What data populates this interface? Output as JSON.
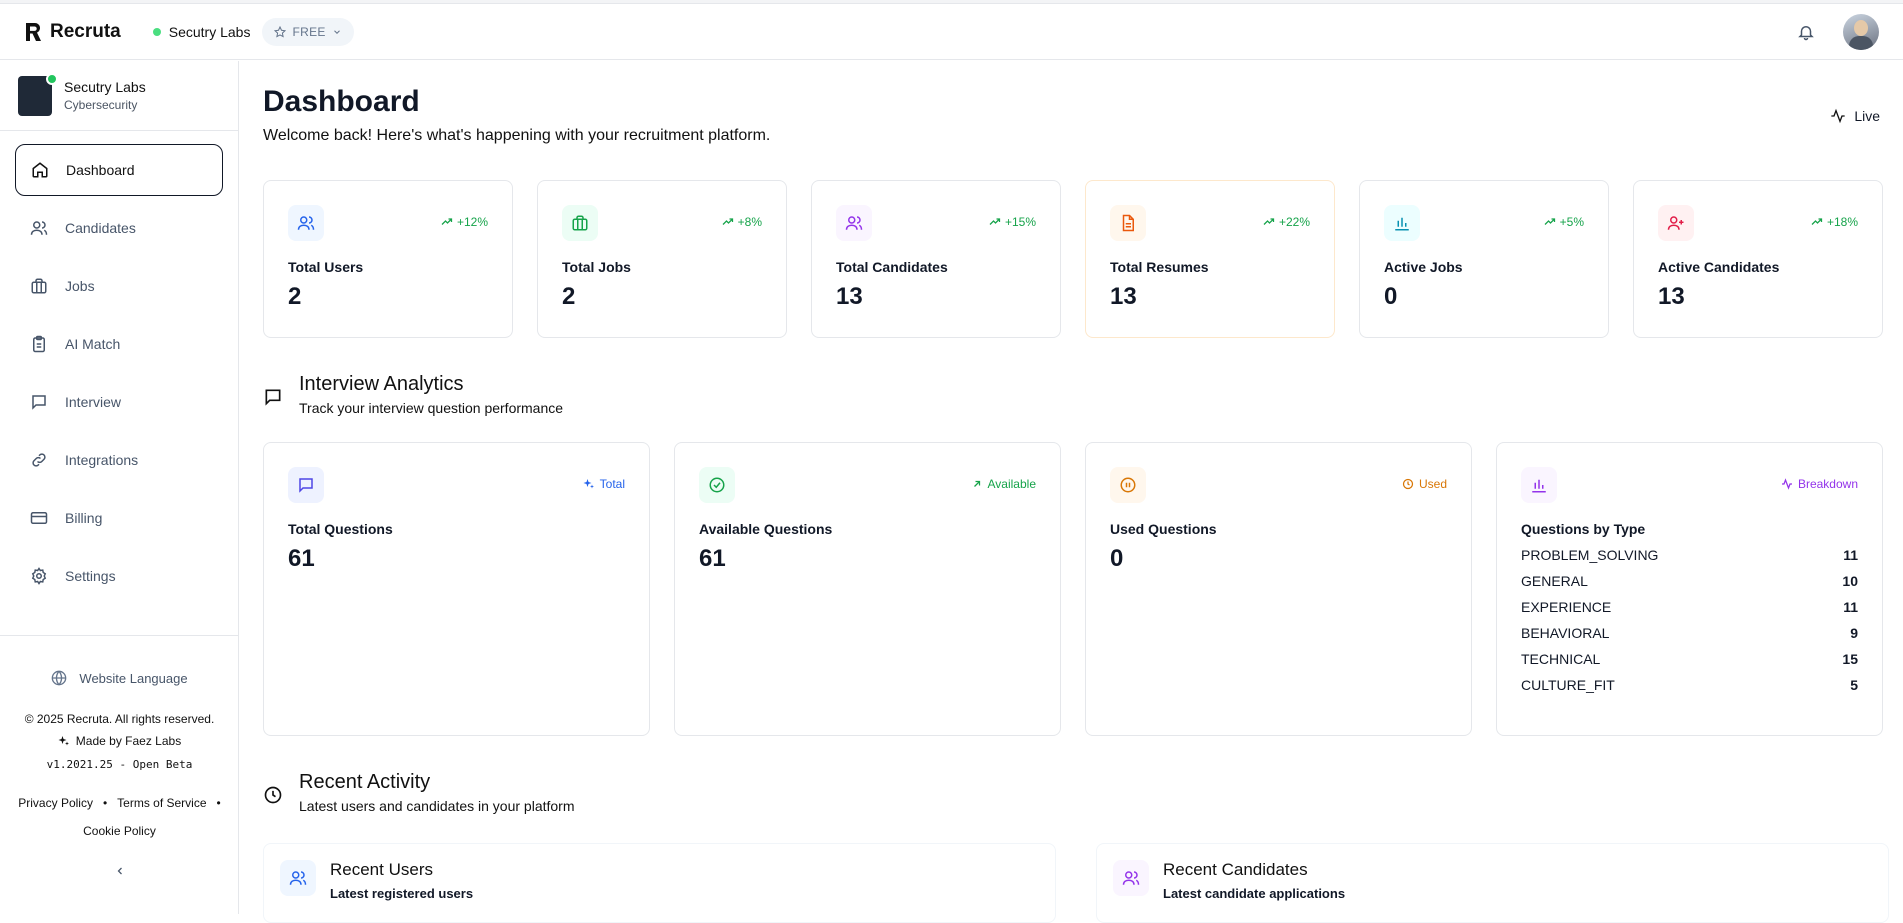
{
  "app": {
    "name": "Recruta"
  },
  "topbar": {
    "org_name": "Secutry Labs",
    "plan": "FREE"
  },
  "sidebar": {
    "org": {
      "name": "Secutry Labs",
      "subtitle": "Cybersecurity"
    },
    "items": [
      {
        "label": "Dashboard",
        "icon": "home-icon"
      },
      {
        "label": "Candidates",
        "icon": "users-icon"
      },
      {
        "label": "Jobs",
        "icon": "briefcase-icon"
      },
      {
        "label": "AI Match",
        "icon": "clipboard-icon"
      },
      {
        "label": "Interview",
        "icon": "chat-icon"
      },
      {
        "label": "Integrations",
        "icon": "link-icon"
      },
      {
        "label": "Billing",
        "icon": "credit-card-icon"
      },
      {
        "label": "Settings",
        "icon": "gear-icon"
      }
    ],
    "footer": {
      "language": "Website Language",
      "copyright": "© 2025 Recruta. All rights reserved.",
      "made_by": "Made by Faez Labs",
      "version": "v1.2021.25 - Open Beta",
      "privacy": "Privacy Policy",
      "terms": "Terms of Service",
      "cookie": "Cookie Policy"
    }
  },
  "header": {
    "title": "Dashboard",
    "subtitle": "Welcome back! Here's what's happening with your recruitment platform.",
    "live": "Live"
  },
  "stats": [
    {
      "label": "Total Users",
      "value": "2",
      "trend": "+12%",
      "icon": "users-icon",
      "color": "#2563eb",
      "bg": "#eff6ff"
    },
    {
      "label": "Total Jobs",
      "value": "2",
      "trend": "+8%",
      "icon": "briefcase-icon",
      "color": "#16a34a",
      "bg": "#ecfdf5"
    },
    {
      "label": "Total Candidates",
      "value": "13",
      "trend": "+15%",
      "icon": "users-icon",
      "color": "#9333ea",
      "bg": "#faf5ff"
    },
    {
      "label": "Total Resumes",
      "value": "13",
      "trend": "+22%",
      "icon": "document-icon",
      "color": "#ea580c",
      "bg": "#fff7ed"
    },
    {
      "label": "Active Jobs",
      "value": "0",
      "trend": "+5%",
      "icon": "bar-chart-icon",
      "color": "#0891b2",
      "bg": "#ecfeff"
    },
    {
      "label": "Active Candidates",
      "value": "13",
      "trend": "+18%",
      "icon": "user-plus-icon",
      "color": "#e11d48",
      "bg": "#fff1f2"
    }
  ],
  "interview": {
    "title": "Interview Analytics",
    "subtitle": "Track your interview question performance",
    "cards": [
      {
        "label": "Total Questions",
        "value": "61",
        "tag": "Total",
        "color": "#2563eb",
        "bg": "#eef2ff"
      },
      {
        "label": "Available Questions",
        "value": "61",
        "tag": "Available",
        "color": "#16a34a",
        "bg": "#ecfdf5"
      },
      {
        "label": "Used Questions",
        "value": "0",
        "tag": "Used",
        "color": "#d97706",
        "bg": "#fff7ed"
      }
    ],
    "by_type": {
      "label": "Questions by Type",
      "tag": "Breakdown",
      "color": "#9333ea",
      "rows": [
        {
          "type": "PROBLEM_SOLVING",
          "count": "11"
        },
        {
          "type": "GENERAL",
          "count": "10"
        },
        {
          "type": "EXPERIENCE",
          "count": "11"
        },
        {
          "type": "BEHAVIORAL",
          "count": "9"
        },
        {
          "type": "TECHNICAL",
          "count": "15"
        },
        {
          "type": "CULTURE_FIT",
          "count": "5"
        }
      ]
    }
  },
  "activity": {
    "title": "Recent Activity",
    "subtitle": "Latest users and candidates in your platform",
    "users": {
      "title": "Recent Users",
      "subtitle": "Latest registered users"
    },
    "candidates": {
      "title": "Recent Candidates",
      "subtitle": "Latest candidate applications"
    }
  }
}
